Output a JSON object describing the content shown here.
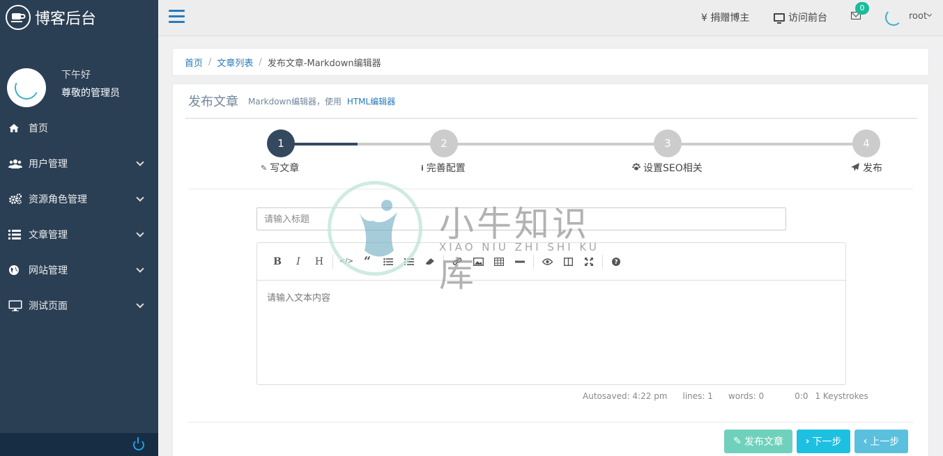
{
  "brand": {
    "title": "博客后台"
  },
  "profile": {
    "greeting": "下午好",
    "name": "尊敬的管理员"
  },
  "sidebar": {
    "items": [
      {
        "label": "首页",
        "icon": "home-icon"
      },
      {
        "label": "用户管理",
        "icon": "users-icon"
      },
      {
        "label": "资源角色管理",
        "icon": "cogs-icon"
      },
      {
        "label": "文章管理",
        "icon": "list-icon"
      },
      {
        "label": "网站管理",
        "icon": "globe-icon"
      },
      {
        "label": "测试页面",
        "icon": "desktop-icon"
      }
    ]
  },
  "topbar": {
    "donate": "¥ 捐赠博主",
    "visit": "访问前台",
    "mail_count": "0",
    "user": "root"
  },
  "breadcrumb": {
    "home": "首页",
    "list": "文章列表",
    "current": "发布文章-Markdown编辑器"
  },
  "panel": {
    "title": "发布文章",
    "subtitle": "Markdown编辑器，使用",
    "subtitle_link": "HTML编辑器"
  },
  "wizard": {
    "steps": [
      {
        "num": "1",
        "label": "写文章",
        "icon": "pencil-icon"
      },
      {
        "num": "2",
        "label": "完善配置",
        "icon": "info-icon"
      },
      {
        "num": "3",
        "label": "设置SEO相关",
        "icon": "paw-icon"
      },
      {
        "num": "4",
        "label": "发布",
        "icon": "send-icon"
      }
    ],
    "current_step": 1
  },
  "form": {
    "title_placeholder": "请输入标题",
    "content_placeholder": "请输入文本内容"
  },
  "editor_status": {
    "autosaved": "Autosaved: 4:22 pm",
    "lines": "lines: 1",
    "words": "words: 0",
    "cursor": "0:0",
    "keystrokes": "1 Keystrokes"
  },
  "buttons": {
    "publish": "发布文章",
    "next": "下一步",
    "prev": "上一步"
  },
  "watermark": {
    "text": "小牛知识库",
    "subtext": "XIAO NIU ZHI SHI KU"
  }
}
